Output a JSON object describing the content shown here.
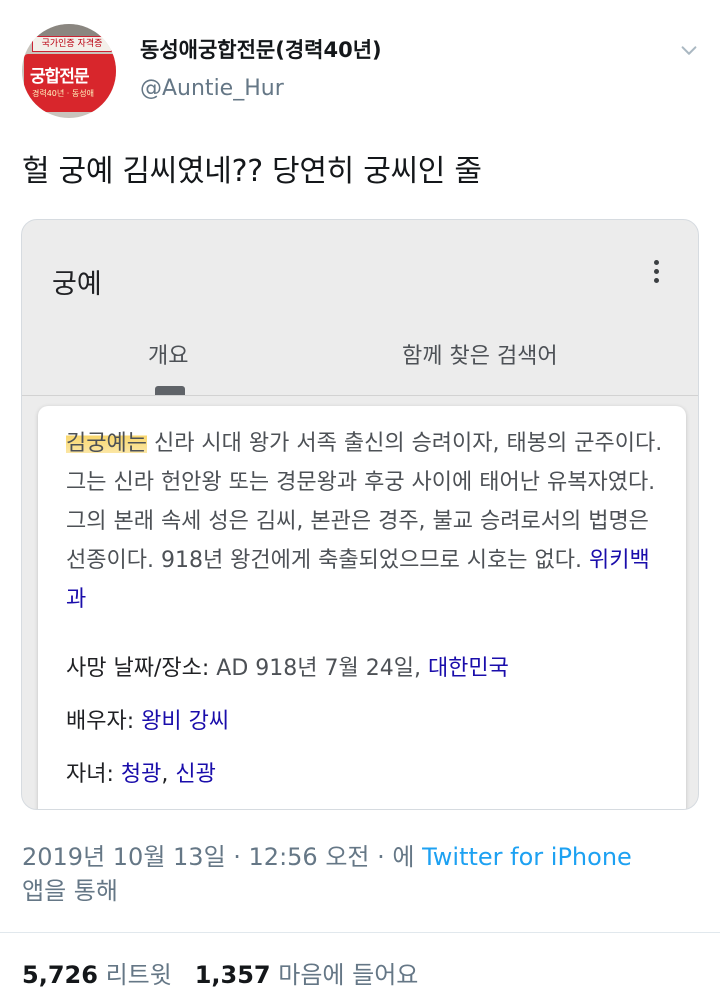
{
  "user": {
    "name": "동성애궁합전문(경력40년)",
    "handle": "@Auntie_Hur",
    "avatar_text_top": "국가인증 자격증",
    "avatar_text_main": "궁합전문",
    "avatar_text_small": "경력40년 · 동성애"
  },
  "tweet": {
    "text": "헐 궁예 김씨였네?? 당연히 궁씨인 줄"
  },
  "card": {
    "title": "궁예",
    "tabs": [
      "개요",
      "함께 찾은 검색어"
    ],
    "description": {
      "highlighted": "김궁예는",
      "body": " 신라 시대 왕가 서족 출신의 승려이자, 태봉의 군주이다. 그는 신라 헌안왕 또는 경문왕과 후궁 사이에 태어난 유복자였다. 그의 본래 속세 성은 김씨, 본관은 경주, 불교 승려로서의 법명은 선종이다. 918년 왕건에게 축출되었으므로 시호는 없다. ",
      "source_link": "위키백과"
    },
    "facts": {
      "death_label": "사망 날짜/장소: ",
      "death_value": "AD 918년 7월 24일, ",
      "death_link": "대한민국",
      "spouse_label": "배우자: ",
      "spouse_link": "왕비 강씨",
      "children_label": "자녀: ",
      "children_link_1": "청광",
      "children_sep": ", ",
      "children_link_2": "신광"
    }
  },
  "meta": {
    "timestamp": "2019년 10월 13일 · 12:56 오전 · 에 ",
    "source": "Twitter for iPhone",
    "suffix": "앱을 통해"
  },
  "stats": {
    "retweets": "5,726",
    "retweets_label": "리트윗",
    "likes": "1,357",
    "likes_label": "마음에 들어요"
  },
  "colors": {
    "link": "#1a0dab",
    "twitter_blue": "#1da1f2",
    "highlight": "#f8d25c",
    "muted": "#657786"
  },
  "icons": [
    "chevron-down-icon",
    "more-vertical-icon"
  ]
}
